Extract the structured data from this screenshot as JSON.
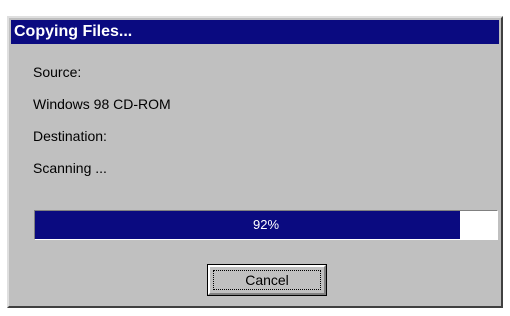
{
  "window": {
    "title": "Copying Files..."
  },
  "fields": {
    "source_label": "Source:",
    "source_value": "Windows 98 CD-ROM",
    "destination_label": "Destination:",
    "status_text": "Scanning ..."
  },
  "progress": {
    "percent": 92,
    "label": "92%"
  },
  "buttons": {
    "cancel_label": "Cancel"
  },
  "colors": {
    "titlebar": "#0a0a80",
    "dialog_face": "#c0c0c0",
    "progress_fill": "#0a0a80"
  }
}
